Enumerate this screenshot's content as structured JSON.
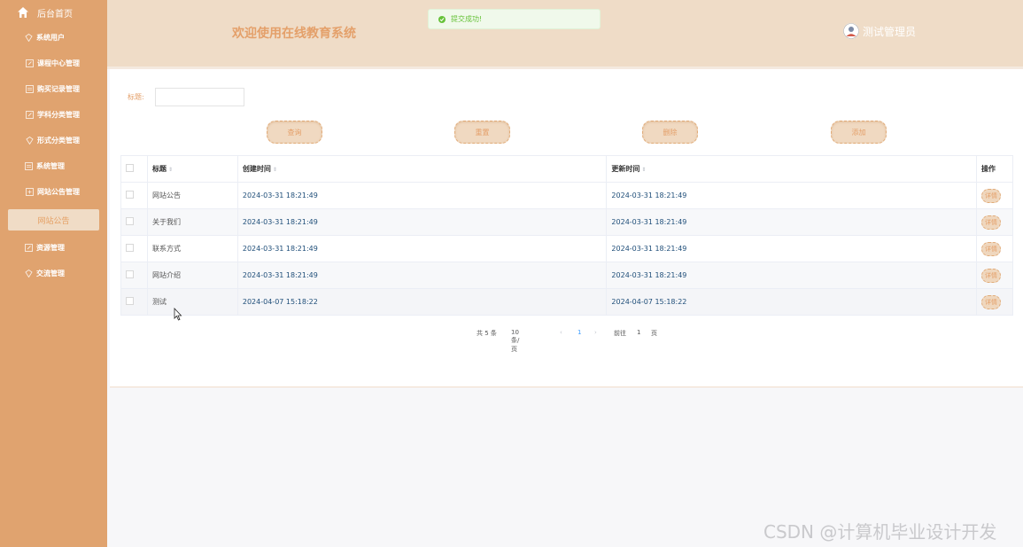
{
  "sidebar": {
    "home_label": "后台首页",
    "items": [
      {
        "label": "系统用户"
      },
      {
        "label": "课程中心管理"
      },
      {
        "label": "购买记录管理"
      },
      {
        "label": "学科分类管理"
      },
      {
        "label": "形式分类管理"
      },
      {
        "label": "系统管理"
      },
      {
        "label": "网站公告管理"
      }
    ],
    "active_sub": "网站公告",
    "items_after": [
      {
        "label": "资源管理"
      },
      {
        "label": "交流管理"
      }
    ]
  },
  "header": {
    "title": "欢迎使用在线教育系统",
    "user": "测试管理员"
  },
  "toast": {
    "message": "提交成功!"
  },
  "search": {
    "label": "标题:",
    "value": "",
    "placeholder": ""
  },
  "buttons": {
    "query": "查询",
    "reset": "重置",
    "delete": "删除",
    "add": "添加"
  },
  "table": {
    "columns": {
      "title": "标题",
      "created": "创建时间",
      "updated": "更新时间",
      "actions": "操作"
    },
    "rows": [
      {
        "title": "网站公告",
        "created": "2024-03-31 18:21:49",
        "updated": "2024-03-31 18:21:49",
        "action": "详情"
      },
      {
        "title": "关于我们",
        "created": "2024-03-31 18:21:49",
        "updated": "2024-03-31 18:21:49",
        "action": "详情"
      },
      {
        "title": "联系方式",
        "created": "2024-03-31 18:21:49",
        "updated": "2024-03-31 18:21:49",
        "action": "详情"
      },
      {
        "title": "网站介绍",
        "created": "2024-03-31 18:21:49",
        "updated": "2024-03-31 18:21:49",
        "action": "详情"
      },
      {
        "title": "测试",
        "created": "2024-04-07 15:18:22",
        "updated": "2024-04-07 15:18:22",
        "action": "详情"
      }
    ]
  },
  "pagination": {
    "total": "共 5 条",
    "page_size": "10条/页",
    "current": "1",
    "goto_label": "前往",
    "goto_value": "1",
    "page_suffix": "页"
  },
  "watermark": "CSDN @计算机毕业设计开发",
  "colors": {
    "sidebar": "#e0a36f",
    "header": "#efdcc7",
    "accent": "#e4a06a",
    "success": "#67c23a"
  }
}
